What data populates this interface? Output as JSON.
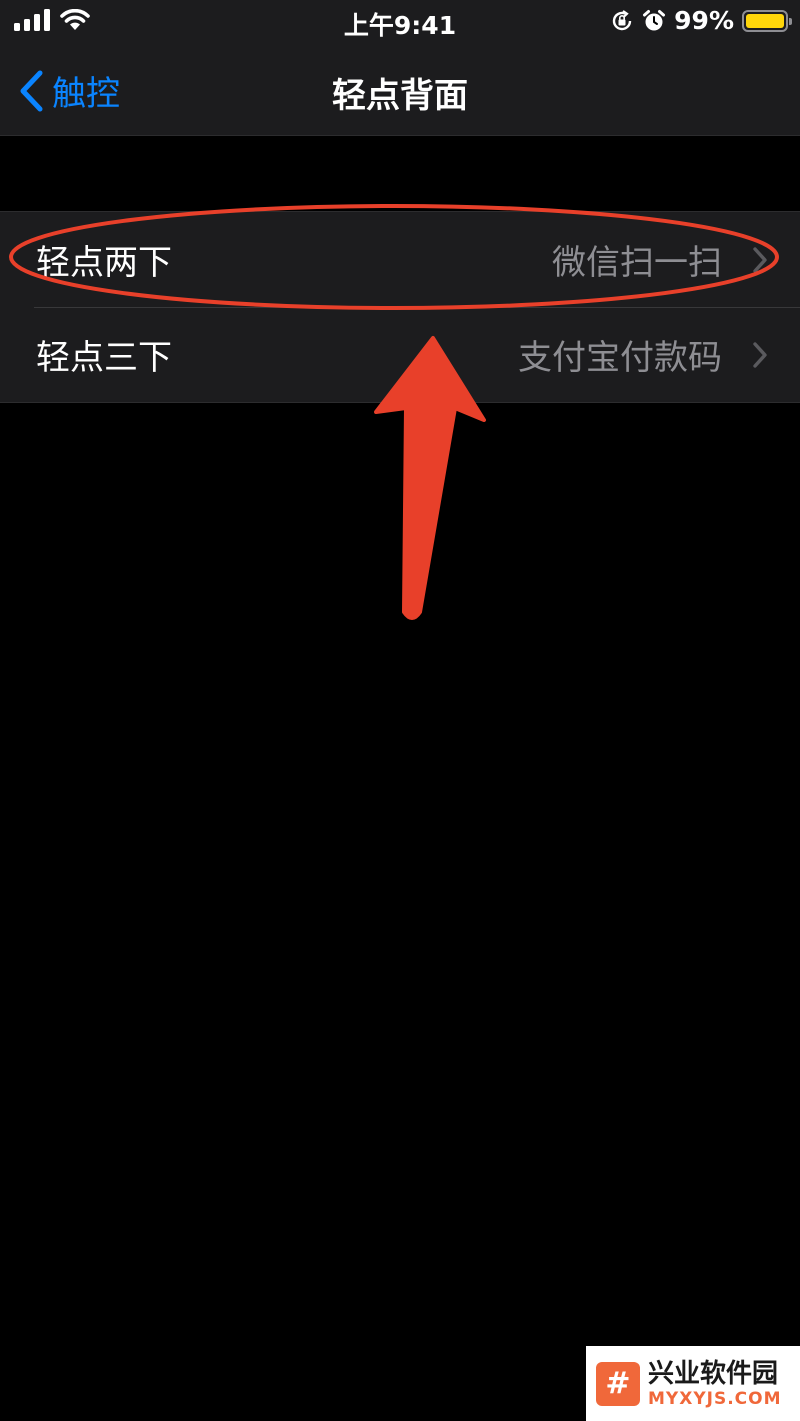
{
  "status_bar": {
    "time": "上午9:41",
    "battery": "99%",
    "battery_level": 0.99
  },
  "nav": {
    "back_label": "触控",
    "title": "轻点背面"
  },
  "rows": [
    {
      "label": "轻点两下",
      "value": "微信扫一扫"
    },
    {
      "label": "轻点三下",
      "value": "支付宝付款码"
    }
  ],
  "watermark": {
    "name_cn": "兴业软件园",
    "name_en": "MYXYJS.COM"
  },
  "colors": {
    "accent": "#0a84ff",
    "annotation": "#e8402a",
    "battery": "#ffd60a"
  }
}
